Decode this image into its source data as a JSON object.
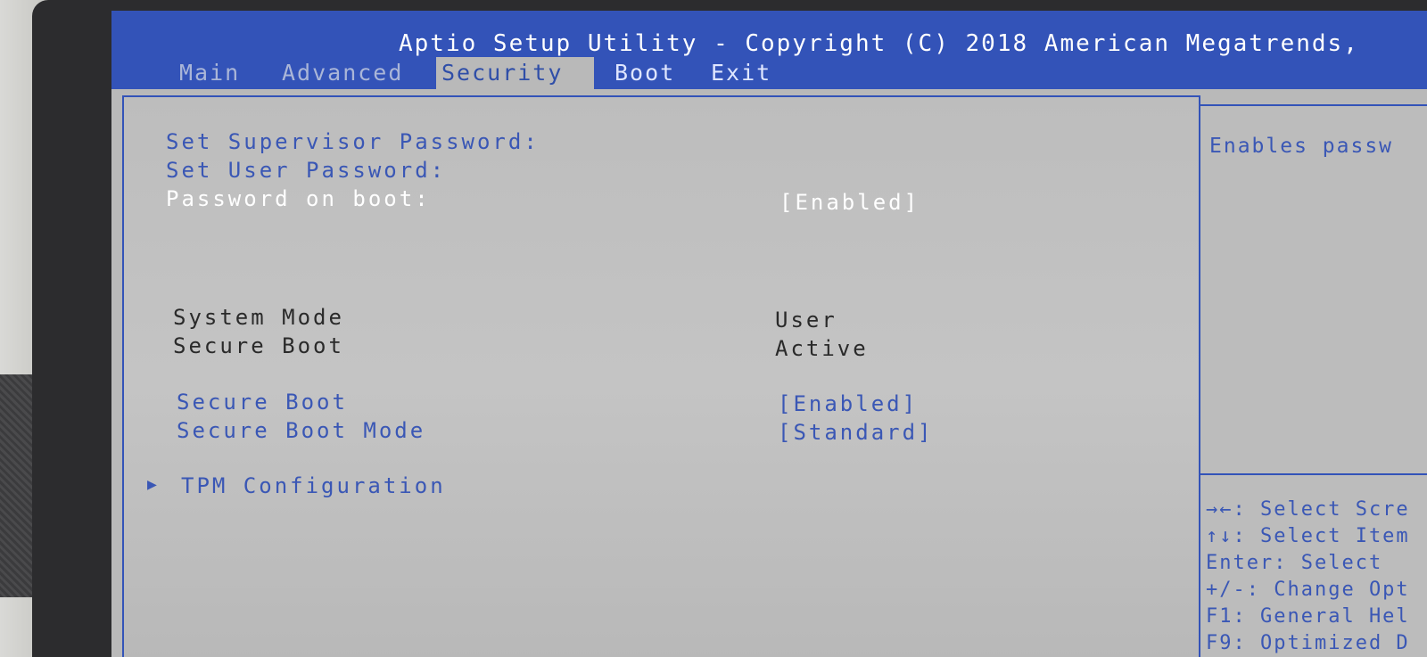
{
  "header": {
    "title": "Aptio Setup Utility - Copyright (C) 2018 American Megatrends,",
    "tabs": [
      "Main",
      "Advanced",
      "Security",
      "Boot",
      "Exit"
    ],
    "active_tab": "Security"
  },
  "security": {
    "supervisor_password_label": "Set Supervisor Password:",
    "user_password_label": "Set User Password:",
    "password_on_boot_label": "Password on boot:",
    "password_on_boot_value": "[Enabled]",
    "system_mode_label": "System Mode",
    "system_mode_value": "User",
    "secure_boot_status_label": "Secure Boot",
    "secure_boot_status_value": "Active",
    "secure_boot_label": "Secure Boot",
    "secure_boot_value": "[Enabled]",
    "secure_boot_mode_label": "Secure Boot Mode",
    "secure_boot_mode_value": "[Standard]",
    "tpm_label": "TPM Configuration",
    "tpm_arrow": "▶"
  },
  "help": {
    "description": "Enables passw",
    "keys": [
      "→←: Select Scre",
      "↑↓: Select Item",
      "Enter: Select",
      "+/-: Change Opt",
      "F1: General Hel",
      "F9: Optimized D"
    ]
  },
  "colors": {
    "header_blue": "#3353b8",
    "panel_gray": "#b9b9b9",
    "item_blue": "#3a57b5",
    "selected_white": "#ffffff"
  }
}
